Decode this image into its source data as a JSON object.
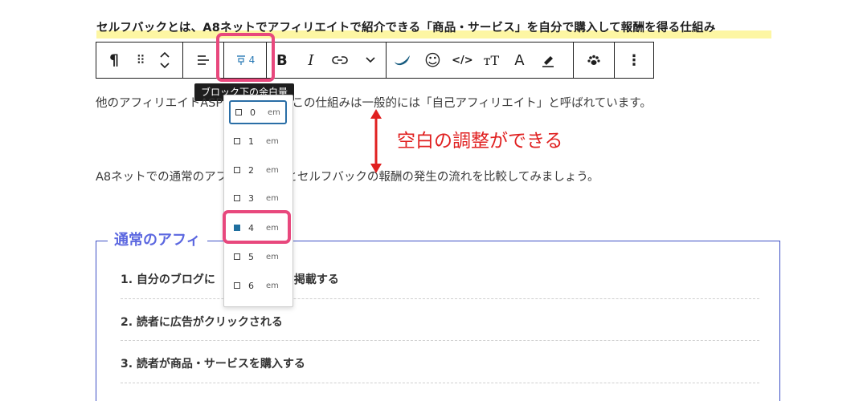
{
  "heading": "セルフバックとは、A8ネットでアフィリエイトで紹介できる「商品・サービス」を自分で購入して報酬を得る仕組み",
  "toolbar": {
    "paragraph_icon": "¶",
    "drag_icon": "⠿",
    "move_icon": "⌃⌄",
    "align_icon": "≡",
    "spacing_value": "4",
    "bold_label": "B",
    "italic_label": "I",
    "link_icon": "link-icon",
    "more_icon": "⌄",
    "emoji_icon": "☺",
    "code_label": "</>",
    "typo_label": "ᴛT",
    "font_label": "A",
    "highlight_icon": "highlighter-icon",
    "paw_icon": "🐾",
    "options_label": "⋮"
  },
  "tooltip": "ブロック下の余白量",
  "paragraph1": "他のアフィリエイトASP名は異なり、この仕組みは一般的には「自己アフィリエイト」と呼ばれています。",
  "paragraph2": "A8ネットでの通常のアフィリエイトとセルフバックの報酬の発生の流れを比較してみましょう。",
  "dropdown": {
    "unit": "em",
    "options": [
      "0",
      "1",
      "2",
      "3",
      "4",
      "5",
      "6"
    ],
    "selected": "4"
  },
  "annotation": "空白の調整ができる",
  "list": {
    "title": "通常のアフィ",
    "items": [
      "1. 自分のブログに　　　　　　を掲載する",
      "2. 読者に広告がクリックされる",
      "3. 読者が商品・サービスを購入する"
    ]
  },
  "colors": {
    "highlight_red": "#e8487d",
    "annotation_red": "#e02020",
    "list_border": "#3d4fc4",
    "list_title": "#5b67e0",
    "selected_blue": "#1f6f9f"
  }
}
